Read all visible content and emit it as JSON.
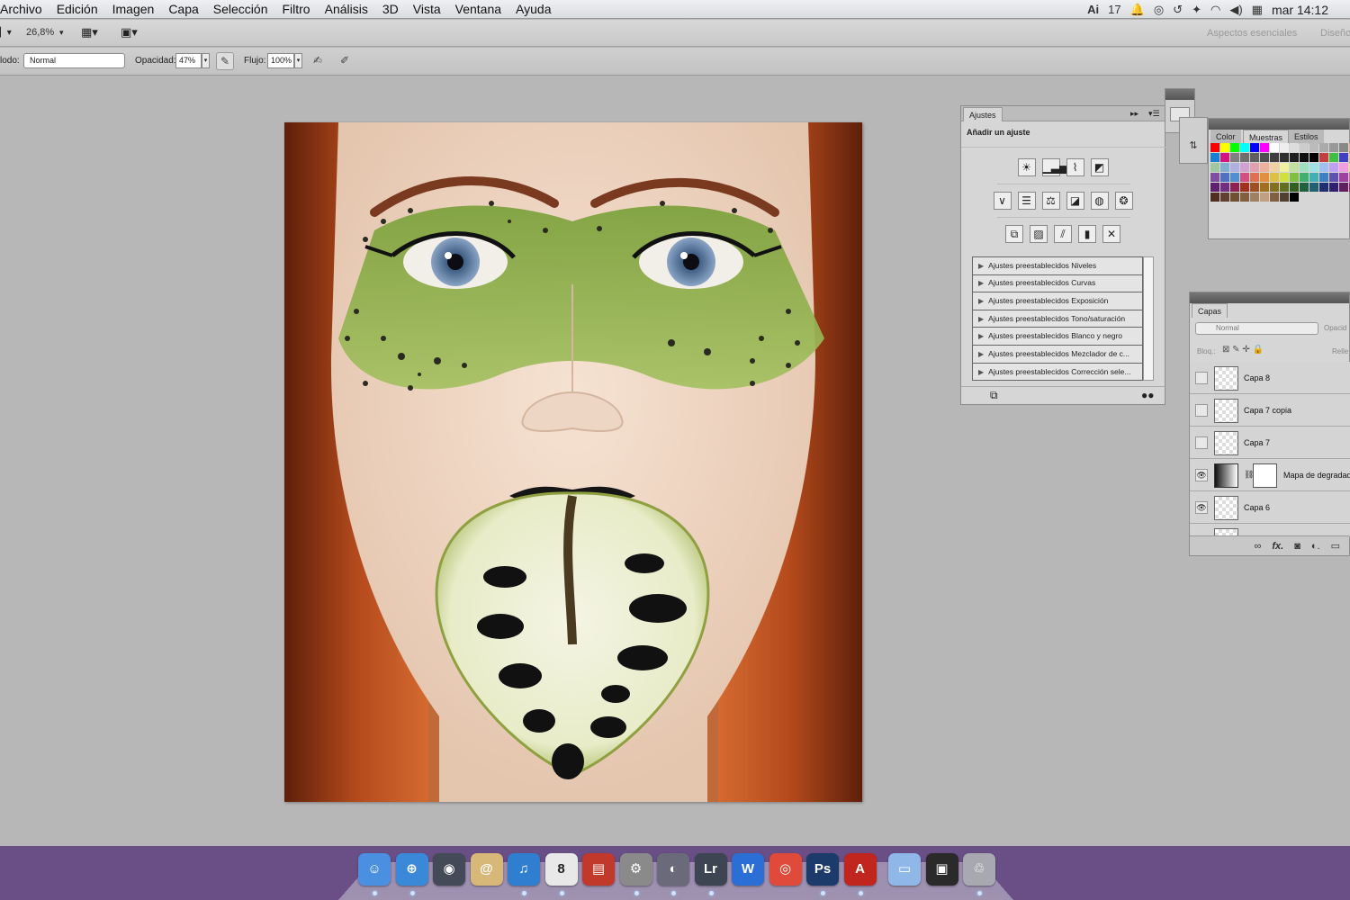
{
  "menubar": {
    "items": [
      "Archivo",
      "Edición",
      "Imagen",
      "Capa",
      "Selección",
      "Filtro",
      "Análisis",
      "3D",
      "Vista",
      "Ventana",
      "Ayuda"
    ],
    "adobe_count": "17",
    "clock": "mar 14:12"
  },
  "appbar": {
    "zoom": "26,8%",
    "workspace_1": "Aspectos esenciales",
    "workspace_2": "Diseño"
  },
  "options": {
    "mode_label": "lodo:",
    "mode_value": "Normal",
    "opacity_label": "Opacidad:",
    "opacity_value": "47%",
    "flow_label": "Flujo:",
    "flow_value": "100%"
  },
  "ajustes": {
    "tab": "Ajustes",
    "subtitle": "Añadir un ajuste",
    "icons_row1": [
      "brightness-icon",
      "levels-icon",
      "curves-icon",
      "exposure-icon"
    ],
    "icons_row2": [
      "vibrance-icon",
      "hue-saturation-icon",
      "color-balance-icon",
      "black-white-icon",
      "photo-filter-icon",
      "channel-mixer-icon"
    ],
    "icons_row3": [
      "invert-icon",
      "posterize-icon",
      "threshold-icon",
      "gradient-map-icon",
      "selective-color-icon"
    ],
    "presets": [
      "Ajustes preestablecidos Niveles",
      "Ajustes preestablecidos Curvas",
      "Ajustes preestablecidos Exposición",
      "Ajustes preestablecidos Tono/saturación",
      "Ajustes preestablecidos Blanco y negro",
      "Ajustes preestablecidos Mezclador de c...",
      "Ajustes preestablecidos Corrección sele..."
    ]
  },
  "swatches": {
    "tabs": [
      "Color",
      "Muestras",
      "Estilos"
    ],
    "colors": [
      "#ff0000",
      "#ffff00",
      "#00ff00",
      "#00ffff",
      "#0000ff",
      "#ff00ff",
      "#ffffff",
      "#eeeeee",
      "#dddddd",
      "#cccccc",
      "#bbbbbb",
      "#aaaaaa",
      "#999999",
      "#888888",
      "#f7a57a",
      "#1a7fd4",
      "#d4147f",
      "#7f7f7f",
      "#6f6f6f",
      "#5f5f5f",
      "#4f4f4f",
      "#3f3f3f",
      "#2f2f2f",
      "#1f1f1f",
      "#101010",
      "#000000",
      "#c04040",
      "#40c040",
      "#4040c0",
      "#f0c070",
      "#a0c8a0",
      "#80b0d0",
      "#b0b0e0",
      "#d0a0d0",
      "#e0a0b0",
      "#f0b0a0",
      "#f0d0a0",
      "#f0f0a0",
      "#c0e0a0",
      "#a0e0c0",
      "#a0e0e0",
      "#a0c0f0",
      "#c0a0f0",
      "#f0a0e0",
      "#f8e070",
      "#8050a0",
      "#5070c0",
      "#5090d0",
      "#d05080",
      "#e07050",
      "#e09040",
      "#e0c040",
      "#d0e040",
      "#80c040",
      "#40b070",
      "#40b0b0",
      "#4080c0",
      "#6050b0",
      "#a040a0",
      "#e060a0",
      "#602070",
      "#703080",
      "#902050",
      "#a03020",
      "#a05020",
      "#a07020",
      "#807020",
      "#607020",
      "#306020",
      "#206040",
      "#206070",
      "#203070",
      "#302070",
      "#602060",
      "#a02060",
      "#503020",
      "#604030",
      "#705030",
      "#806040",
      "#a08060",
      "#c0a080",
      "#806040",
      "#504030",
      "#000000"
    ]
  },
  "capas": {
    "tab": "Capas",
    "blend_mode": "Normal",
    "opacity_label": "Opacid",
    "lock_label": "Bloq.:",
    "fill_label": "Relle",
    "layers": [
      {
        "name": "Capa 8",
        "visible": false
      },
      {
        "name": "Capa 7 copia",
        "visible": false
      },
      {
        "name": "Capa 7",
        "visible": false
      },
      {
        "name": "Mapa de degradado",
        "visible": true
      },
      {
        "name": "Capa 6",
        "visible": true
      }
    ]
  },
  "dock": {
    "apps": [
      {
        "name": "finder-icon",
        "glyph": "☺",
        "color": "#4a8fe0"
      },
      {
        "name": "safari-icon",
        "glyph": "⊕",
        "color": "#3a88d8"
      },
      {
        "name": "camera-icon",
        "glyph": "◉",
        "color": "#444a58"
      },
      {
        "name": "contacts-icon",
        "glyph": "@",
        "color": "#d8b878"
      },
      {
        "name": "itunes-icon",
        "glyph": "♫",
        "color": "#2f7ed0"
      },
      {
        "name": "ical-icon",
        "glyph": "8",
        "color": "#e8e8e8"
      },
      {
        "name": "photo-booth-icon",
        "glyph": "▤",
        "color": "#c0392b"
      },
      {
        "name": "system-prefs-icon",
        "glyph": "⚙",
        "color": "#8a8a8a"
      },
      {
        "name": "time-machine-icon",
        "glyph": "◐",
        "color": "#6a6a7a"
      },
      {
        "name": "lightroom-icon",
        "glyph": "Lr",
        "color": "#3d4552"
      },
      {
        "name": "word-icon",
        "glyph": "W",
        "color": "#2b6ed6"
      },
      {
        "name": "chrome-icon",
        "glyph": "◎",
        "color": "#e04a3a"
      },
      {
        "name": "photoshop-icon",
        "glyph": "Ps",
        "color": "#1c3a6a"
      },
      {
        "name": "acrobat-icon",
        "glyph": "A",
        "color": "#c0261d"
      },
      {
        "name": "folder-icon",
        "glyph": "▭",
        "color": "#8fb8e8"
      },
      {
        "name": "preview-icon",
        "glyph": "▣",
        "color": "#2a2a2a"
      },
      {
        "name": "trash-icon",
        "glyph": "♲",
        "color": "#a8a8b0"
      }
    ]
  }
}
